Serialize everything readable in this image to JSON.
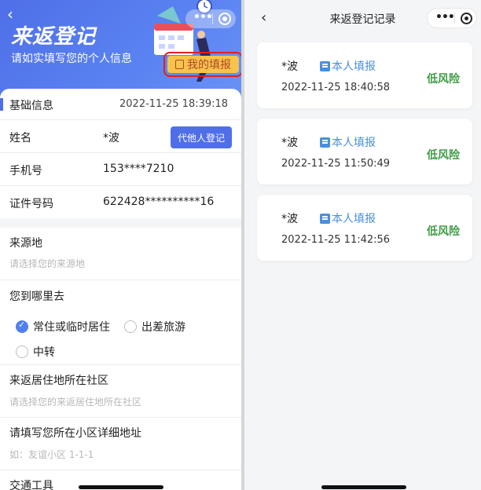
{
  "left": {
    "banner": {
      "back_icon": "chevron-left-icon",
      "title": "来返登记",
      "subtitle": "请如实填写您的个人信息",
      "my_fill_label": "我的填报",
      "my_fill_icon": "edit-note-icon"
    },
    "basic": {
      "section_title": "基础信息",
      "timestamp": "2022-11-25 18:39:18"
    },
    "fields": {
      "name_label": "姓名",
      "name_value": "*波",
      "proxy_button": "代他人登记",
      "phone_label": "手机号",
      "phone_value": "153****7210",
      "id_label": "证件号码",
      "id_value": "622428**********16",
      "origin_label": "来源地",
      "origin_placeholder": "请选择您的来源地",
      "dest_label": "您到哪里去",
      "dest_options": [
        {
          "label": "常住或临时居住",
          "selected": true
        },
        {
          "label": "出差旅游",
          "selected": false
        },
        {
          "label": "中转",
          "selected": false
        }
      ],
      "community_label": "来返居住地所在社区",
      "community_placeholder": "请选择您的来返居住地所在社区",
      "address_label": "请填写您所在小区详细地址",
      "address_placeholder": "如：友谊小区 1-1-1",
      "transport_label": "交通工具"
    }
  },
  "right": {
    "nav": {
      "back_icon": "chevron-left-icon",
      "title": "来返登记记录",
      "more_icon": "more-dots-icon",
      "close_icon": "target-close-icon"
    },
    "records": [
      {
        "name": "*波",
        "source": "本人填报",
        "time": "2022-11-25 18:40:58",
        "risk": "低风险"
      },
      {
        "name": "*波",
        "source": "本人填报",
        "time": "2022-11-25 11:50:49",
        "risk": "低风险"
      },
      {
        "name": "*波",
        "source": "本人填报",
        "time": "2022-11-25 11:42:56",
        "risk": "低风险"
      }
    ]
  },
  "colors": {
    "primary": "#4f6fe8",
    "highlight_border": "#e02020",
    "badge": "#f6c34b",
    "risk_low": "#3f9b47",
    "self_report": "#4a8fe0"
  }
}
